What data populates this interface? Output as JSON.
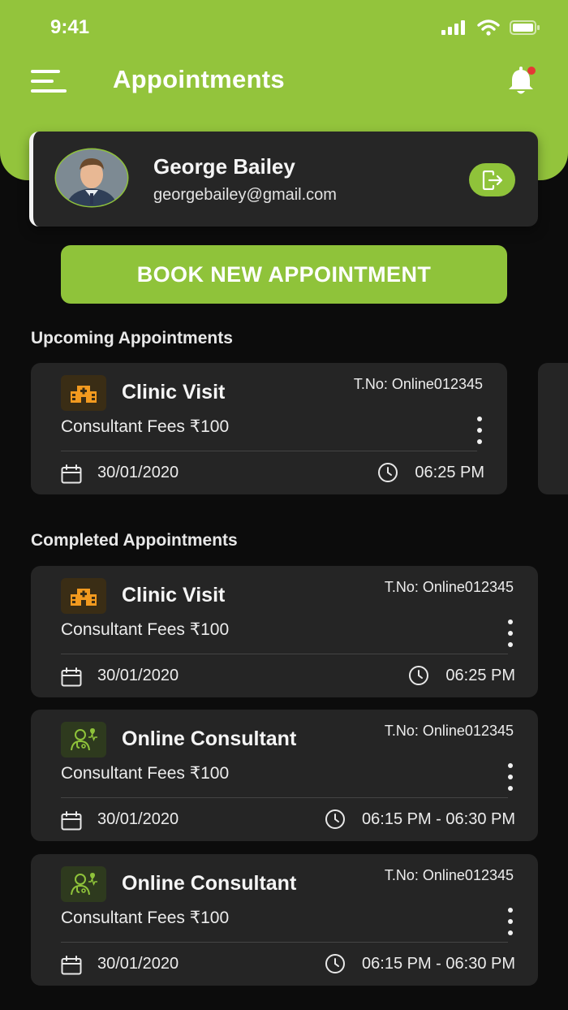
{
  "status_bar": {
    "time": "9:41"
  },
  "header": {
    "title": "Appointments"
  },
  "profile": {
    "name": "George Bailey",
    "email": "georgebailey@gmail.com"
  },
  "book_button": {
    "label": "BOOK NEW APPOINTMENT"
  },
  "colors": {
    "accent": "#8fc33a",
    "header": "#93c43c",
    "background": "#0c0c0c",
    "card": "#252525",
    "notification_dot": "#e53935"
  },
  "icons": [
    "menu-icon",
    "bell-icon",
    "logout-icon",
    "hospital-icon",
    "doctor-online-icon",
    "calendar-icon",
    "clock-icon",
    "more-vertical-icon"
  ],
  "upcoming": {
    "title": "Upcoming Appointments",
    "items": [
      {
        "type": "Clinic Visit",
        "token": "T.No: Online012345",
        "fees": "Consultant Fees ₹100",
        "date": "30/01/2020",
        "time": "06:25 PM"
      }
    ]
  },
  "completed": {
    "title": "Completed Appointments",
    "items": [
      {
        "type": "Clinic Visit",
        "token": "T.No: Online012345",
        "fees": "Consultant Fees ₹100",
        "date": "30/01/2020",
        "time": "06:25 PM"
      },
      {
        "type": "Online Consultant",
        "token": "T.No: Online012345",
        "fees": "Consultant Fees ₹100",
        "date": "30/01/2020",
        "time": "06:15 PM - 06:30 PM"
      },
      {
        "type": "Online Consultant",
        "token": "T.No: Online012345",
        "fees": "Consultant Fees ₹100",
        "date": "30/01/2020",
        "time": "06:15 PM - 06:30 PM"
      }
    ]
  }
}
